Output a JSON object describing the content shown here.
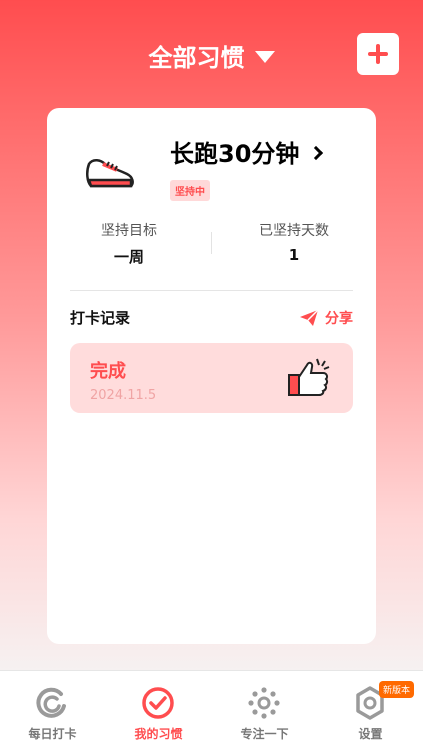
{
  "header": {
    "title": "全部习惯"
  },
  "habit": {
    "name": "长跑30分钟",
    "status_badge": "坚持中",
    "stats": {
      "goal_label": "坚持目标",
      "goal_value": "一周",
      "days_label": "已坚持天数",
      "days_value": "1"
    }
  },
  "records": {
    "title": "打卡记录",
    "share_label": "分享",
    "items": [
      {
        "status": "完成",
        "date": "2024.11.5"
      }
    ]
  },
  "tabs": [
    {
      "label": "每日打卡",
      "icon": "daily-checkin-icon"
    },
    {
      "label": "我的习惯",
      "icon": "my-habits-icon",
      "active": true
    },
    {
      "label": "专注一下",
      "icon": "focus-icon"
    },
    {
      "label": "设置",
      "icon": "settings-icon",
      "badge": "新版本"
    }
  ],
  "colors": {
    "accent": "#ff4d4f",
    "badge": "#ff6a00"
  }
}
